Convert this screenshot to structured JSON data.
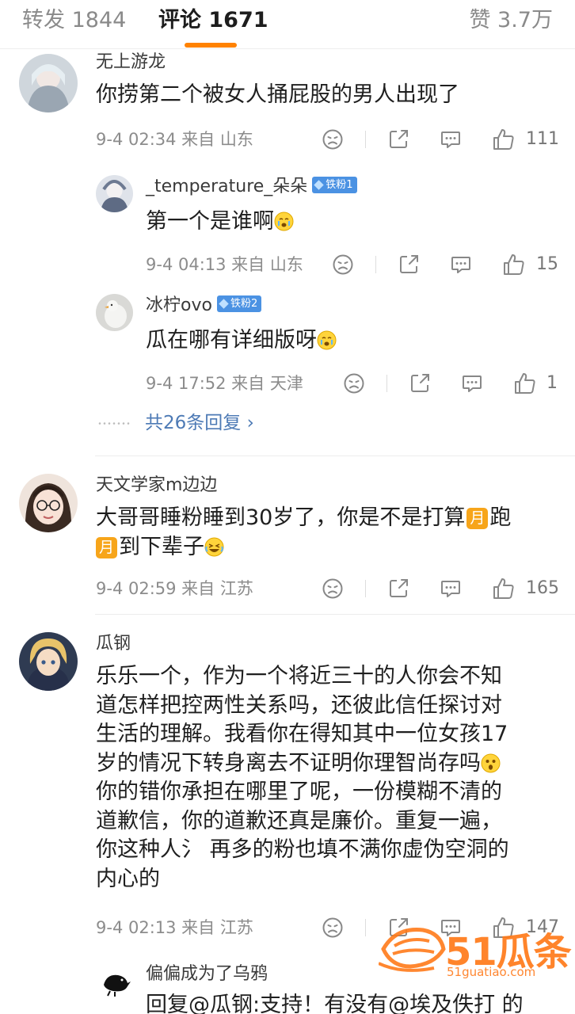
{
  "tabs": {
    "forward": "转发 1844",
    "comments": "评论 1671",
    "likes": "赞 3.7万"
  },
  "accent_color": "#ff8200",
  "comments": [
    {
      "username": "无上游龙",
      "text": "你捞第二个被女人捅屁股的男人出现了",
      "meta": "9-4 02:34 来自 山东",
      "likes": "111"
    },
    {
      "username": "天文学家m边边",
      "text_part1": "大哥哥睡粉睡到30岁了，你是不是打算",
      "moon_glyph": "月",
      "text_part2": "跑",
      "text_part3": "到下辈子",
      "meta": "9-4 02:59 来自 江苏",
      "likes": "165"
    },
    {
      "username": "瓜钢",
      "lines": [
        "乐乐一个，作为一个将近三十的人你会不知",
        "道怎样把控两性关系吗，还彼此信任探讨对",
        "生活的理解。我看你在得知其中一位女孩17",
        "岁的情况下转身离去不证明你理智尚存吗",
        "你的错你承担在哪里了呢，一份模糊不清的",
        "道歉信，你的道歉还真是廉价。重复一遍，",
        "你这种人氵 再多的粉也填不满你虚伪空洞的",
        "内心的"
      ],
      "meta": "9-4 02:13 来自 江苏",
      "likes": "147"
    }
  ],
  "replies": [
    {
      "username": "_temperature_朵朵",
      "badge": "铁粉1",
      "text": "第一个是谁啊",
      "meta": "9-4 04:13 来自 山东",
      "likes": "15"
    },
    {
      "username": "冰柠ovo",
      "badge": "铁粉2",
      "text": "瓜在哪有详细版呀",
      "meta": "9-4 17:52 来自 天津",
      "likes": "1"
    },
    {
      "username": "偏偏成为了乌鸦",
      "text": "回复@瓜钢:支持！有没有@埃及佚打 的"
    }
  ],
  "more_replies": "共26条回复 ›",
  "watermark": {
    "brand": "51瓜条",
    "domain": "51guatiao.com"
  }
}
